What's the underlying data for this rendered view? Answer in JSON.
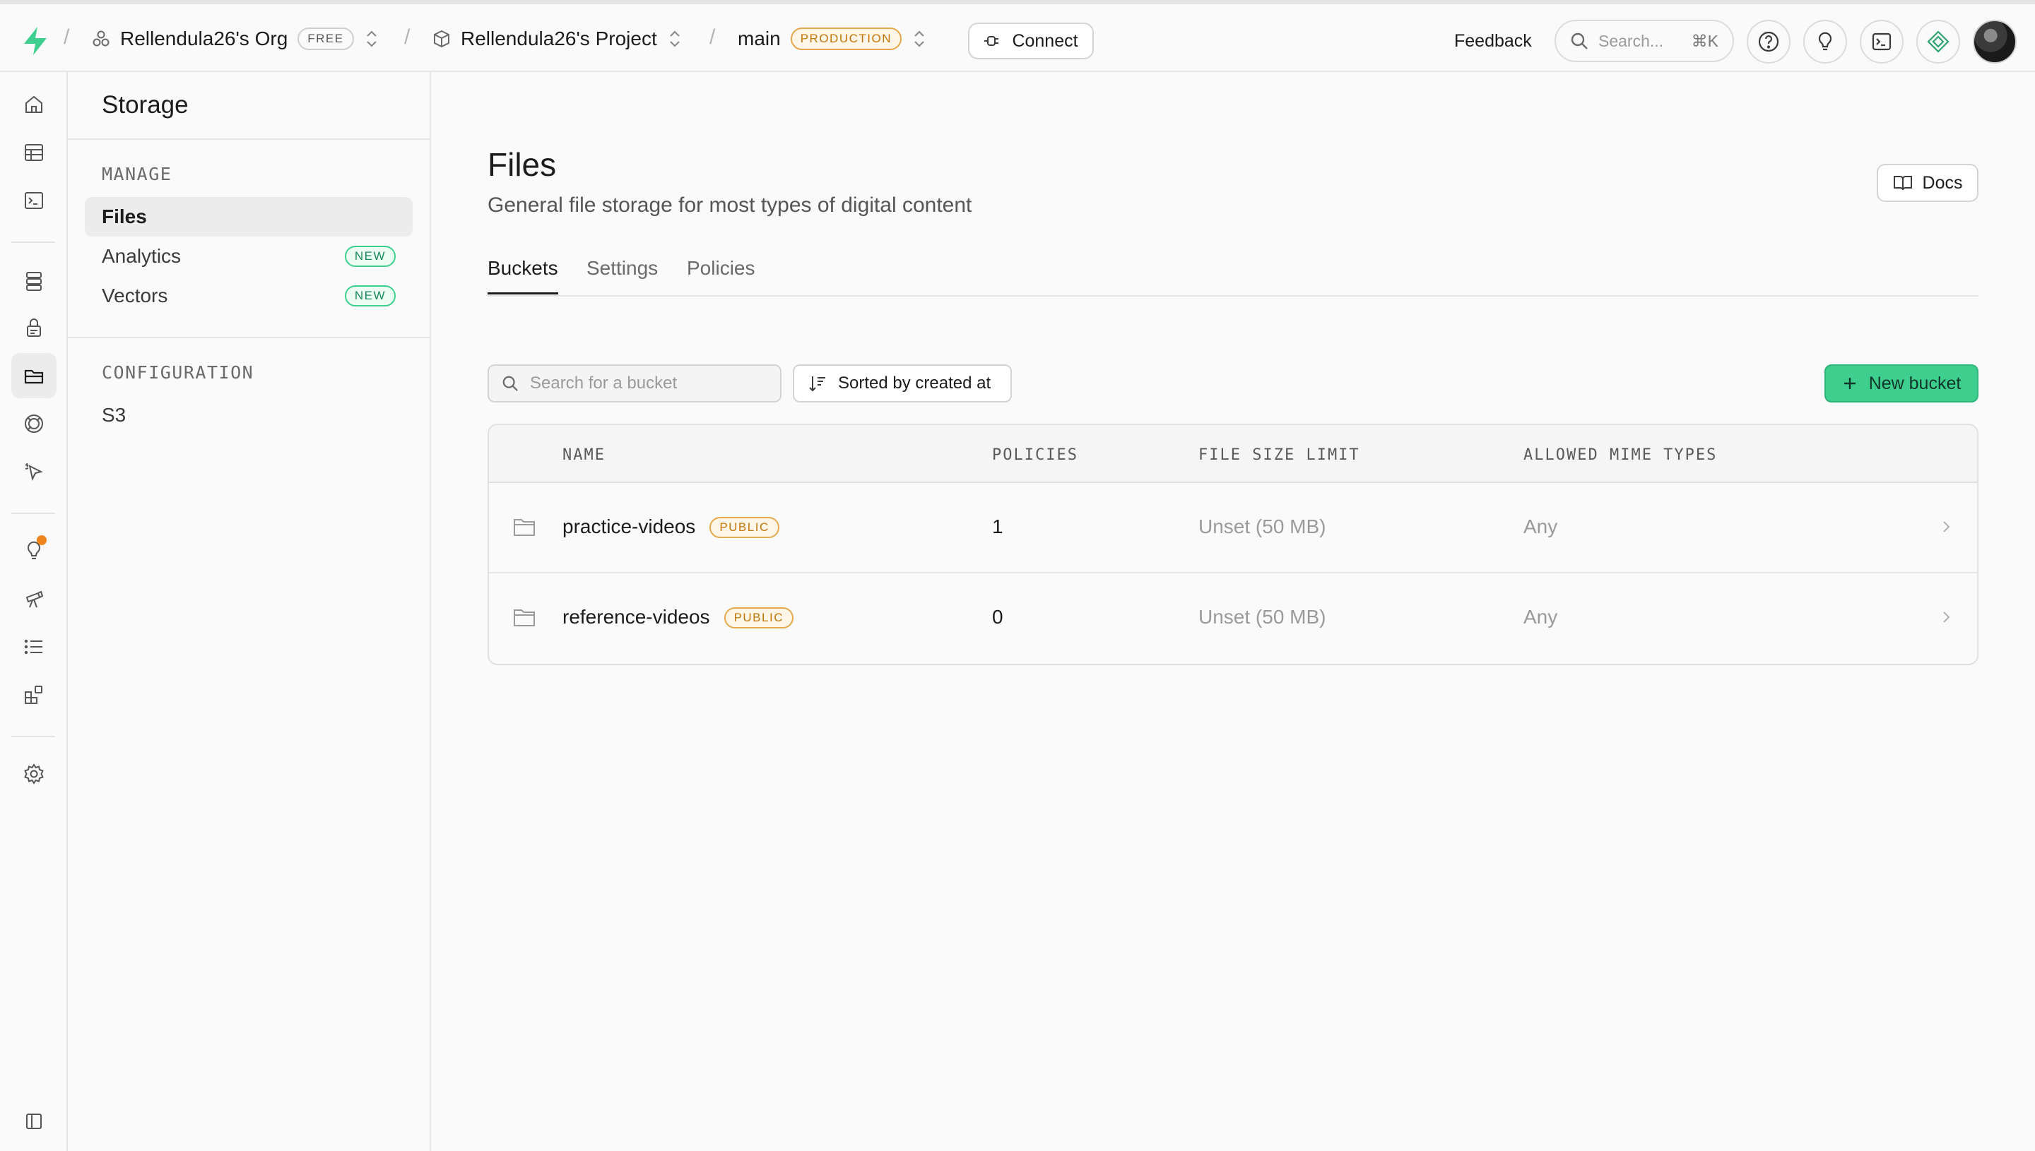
{
  "topbar": {
    "org_name": "Rellendula26's Org",
    "org_plan": "FREE",
    "project_name": "Rellendula26's Project",
    "branch": "main",
    "branch_env": "PRODUCTION",
    "connect_label": "Connect",
    "feedback_label": "Feedback",
    "search_placeholder": "Search...",
    "search_shortcut": "⌘K"
  },
  "rail": {
    "icons": [
      "home-icon",
      "table-editor-icon",
      "sql-editor-icon",
      "database-icon",
      "auth-icon",
      "storage-icon",
      "realtime-icon",
      "edge-functions-icon",
      "advisors-icon",
      "reports-icon",
      "logs-icon",
      "integrations-icon",
      "settings-icon",
      "collapse-icon"
    ],
    "active": "storage-icon"
  },
  "sidebar": {
    "title": "Storage",
    "manage_title": "MANAGE",
    "manage_items": [
      {
        "label": "Files",
        "badge": ""
      },
      {
        "label": "Analytics",
        "badge": "NEW"
      },
      {
        "label": "Vectors",
        "badge": "NEW"
      }
    ],
    "config_title": "CONFIGURATION",
    "config_items": [
      {
        "label": "S3"
      }
    ]
  },
  "main": {
    "title": "Files",
    "subtitle": "General file storage for most types of digital content",
    "docs_label": "Docs",
    "tabs": [
      "Buckets",
      "Settings",
      "Policies"
    ],
    "active_tab": "Buckets",
    "search_placeholder": "Search for a bucket",
    "sort_label": "Sorted by created at",
    "new_bucket_label": "New bucket",
    "table": {
      "columns": [
        "NAME",
        "POLICIES",
        "FILE SIZE LIMIT",
        "ALLOWED MIME TYPES"
      ],
      "rows": [
        {
          "name": "practice-videos",
          "badge": "PUBLIC",
          "policies": "1",
          "size_limit": "Unset (50 MB)",
          "mime": "Any"
        },
        {
          "name": "reference-videos",
          "badge": "PUBLIC",
          "policies": "0",
          "size_limit": "Unset (50 MB)",
          "mime": "Any"
        }
      ]
    }
  },
  "colors": {
    "brand": "#3ecf8e",
    "warning": "#c2750a",
    "notify": "#f0841c"
  }
}
